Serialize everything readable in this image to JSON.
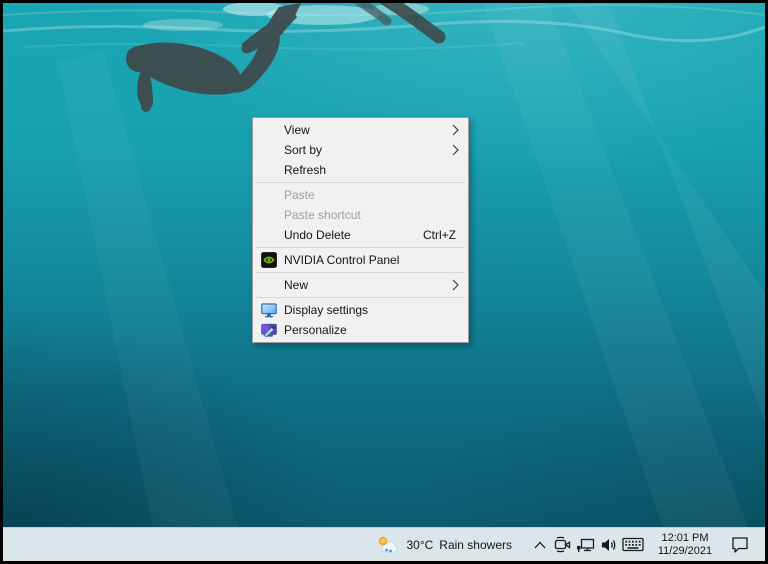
{
  "context_menu": {
    "items": [
      {
        "label": "View",
        "has_submenu": true
      },
      {
        "label": "Sort by",
        "has_submenu": true
      },
      {
        "label": "Refresh"
      },
      {
        "type": "separator"
      },
      {
        "label": "Paste",
        "disabled": true
      },
      {
        "label": "Paste shortcut",
        "disabled": true
      },
      {
        "label": "Undo Delete",
        "shortcut": "Ctrl+Z"
      },
      {
        "type": "separator"
      },
      {
        "label": "NVIDIA Control Panel",
        "icon": "nvidia-icon"
      },
      {
        "type": "separator"
      },
      {
        "label": "New",
        "has_submenu": true
      },
      {
        "type": "separator"
      },
      {
        "label": "Display settings",
        "icon": "display-icon"
      },
      {
        "label": "Personalize",
        "icon": "personalize-icon"
      }
    ],
    "colors": {
      "background": "#f1f1f1",
      "border": "#9b9b9b",
      "text": "#141414",
      "disabled_text": "#9f9f9f"
    }
  },
  "taskbar": {
    "weather": {
      "temperature": "30°C",
      "condition": "Rain showers",
      "icon": "sun-rain-icon"
    },
    "tray_icons": [
      "chevron-up-icon",
      "meet-now-icon",
      "network-icon",
      "volume-icon",
      "touch-keyboard-icon"
    ],
    "clock": {
      "time": "12:01 PM",
      "date": "11/29/2021"
    },
    "action_center": "action-center-icon",
    "colors": {
      "background": "#dbe6ea",
      "icon": "#1c1c1c"
    }
  },
  "wallpaper": {
    "theme": "underwater swimmer in teal water",
    "colors": {
      "water_top": "#1ba7b4",
      "water_bottom": "#0c5c70",
      "silhouette": "#3e4a4c"
    },
    "nvidia_green": "#76b900"
  }
}
